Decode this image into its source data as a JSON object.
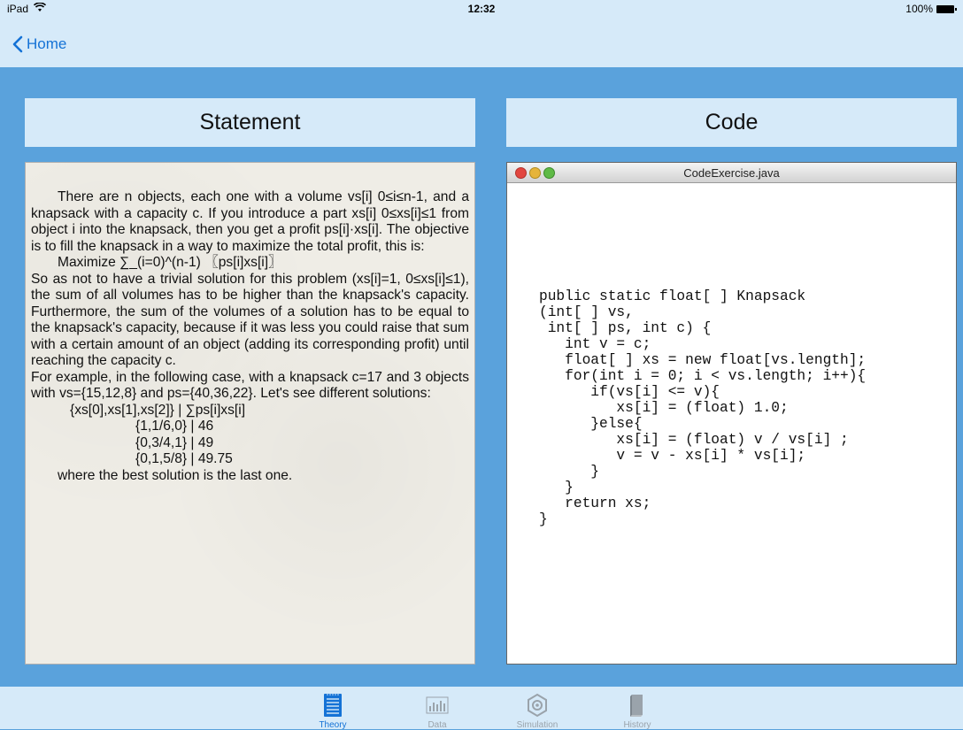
{
  "status_bar": {
    "device": "iPad",
    "time": "12:32",
    "battery": "100%"
  },
  "nav": {
    "back_label": "Home"
  },
  "panels": {
    "statement_title": "Statement",
    "code_title": "Code"
  },
  "statement": {
    "lines": [
      "There are n objects, each one with a volume vs[i] 0≤i≤n-1, and a knapsack with a capacity c. If you introduce a part xs[i] 0≤xs[i]≤1 from object i into the knapsack, then you get a profit ps[i]·xs[i]. The objective is to fill the knapsack in a way to maximize the total profit, this is:",
      "Maximize ∑_(i=0)^(n-1) 〖ps[i]xs[i]〗",
      "So as not to have a trivial solution for this problem (xs[i]=1, 0≤xs[i]≤1), the sum of all volumes has to be higher than the knapsack's capacity. Furthermore, the sum of the volumes of a solution has to be equal to the knapsack's capacity, because if it was less you could raise that sum with a certain amount of an object (adding its corresponding profit) until reaching the capacity c.",
      "For example, in the following case, with a knapsack c=17 and 3 objects with vs={15,12,8} and ps={40,36,22}. Let's see different solutions:",
      "{xs[0],xs[1],xs[2]} | ∑ps[i]xs[i]",
      "{1,1/6,0} | 46",
      "{0,3/4,1} | 49",
      "{0,1,5/8} | 49.75",
      "where the best solution is the last one."
    ]
  },
  "code_window": {
    "filename": "CodeExercise.java",
    "code": "public static float[ ] Knapsack\n(int[ ] vs,\n int[ ] ps, int c) {\n   int v = c;\n   float[ ] xs = new float[vs.length];\n   for(int i = 0; i < vs.length; i++){\n      if(vs[i] <= v){\n         xs[i] = (float) 1.0;\n      }else{\n         xs[i] = (float) v / vs[i] ;\n         v = v - xs[i] * vs[i];\n      }\n   }\n   return xs;\n}"
  },
  "tabs": [
    {
      "label": "Theory",
      "icon": "document-icon",
      "active": true
    },
    {
      "label": "Data",
      "icon": "bar-chart-icon",
      "active": false
    },
    {
      "label": "Simulation",
      "icon": "gear-box-icon",
      "active": false
    },
    {
      "label": "History",
      "icon": "book-icon",
      "active": false
    }
  ],
  "colors": {
    "background": "#5aa2dc",
    "bar": "#d6eaf9",
    "accent": "#1472d6"
  }
}
